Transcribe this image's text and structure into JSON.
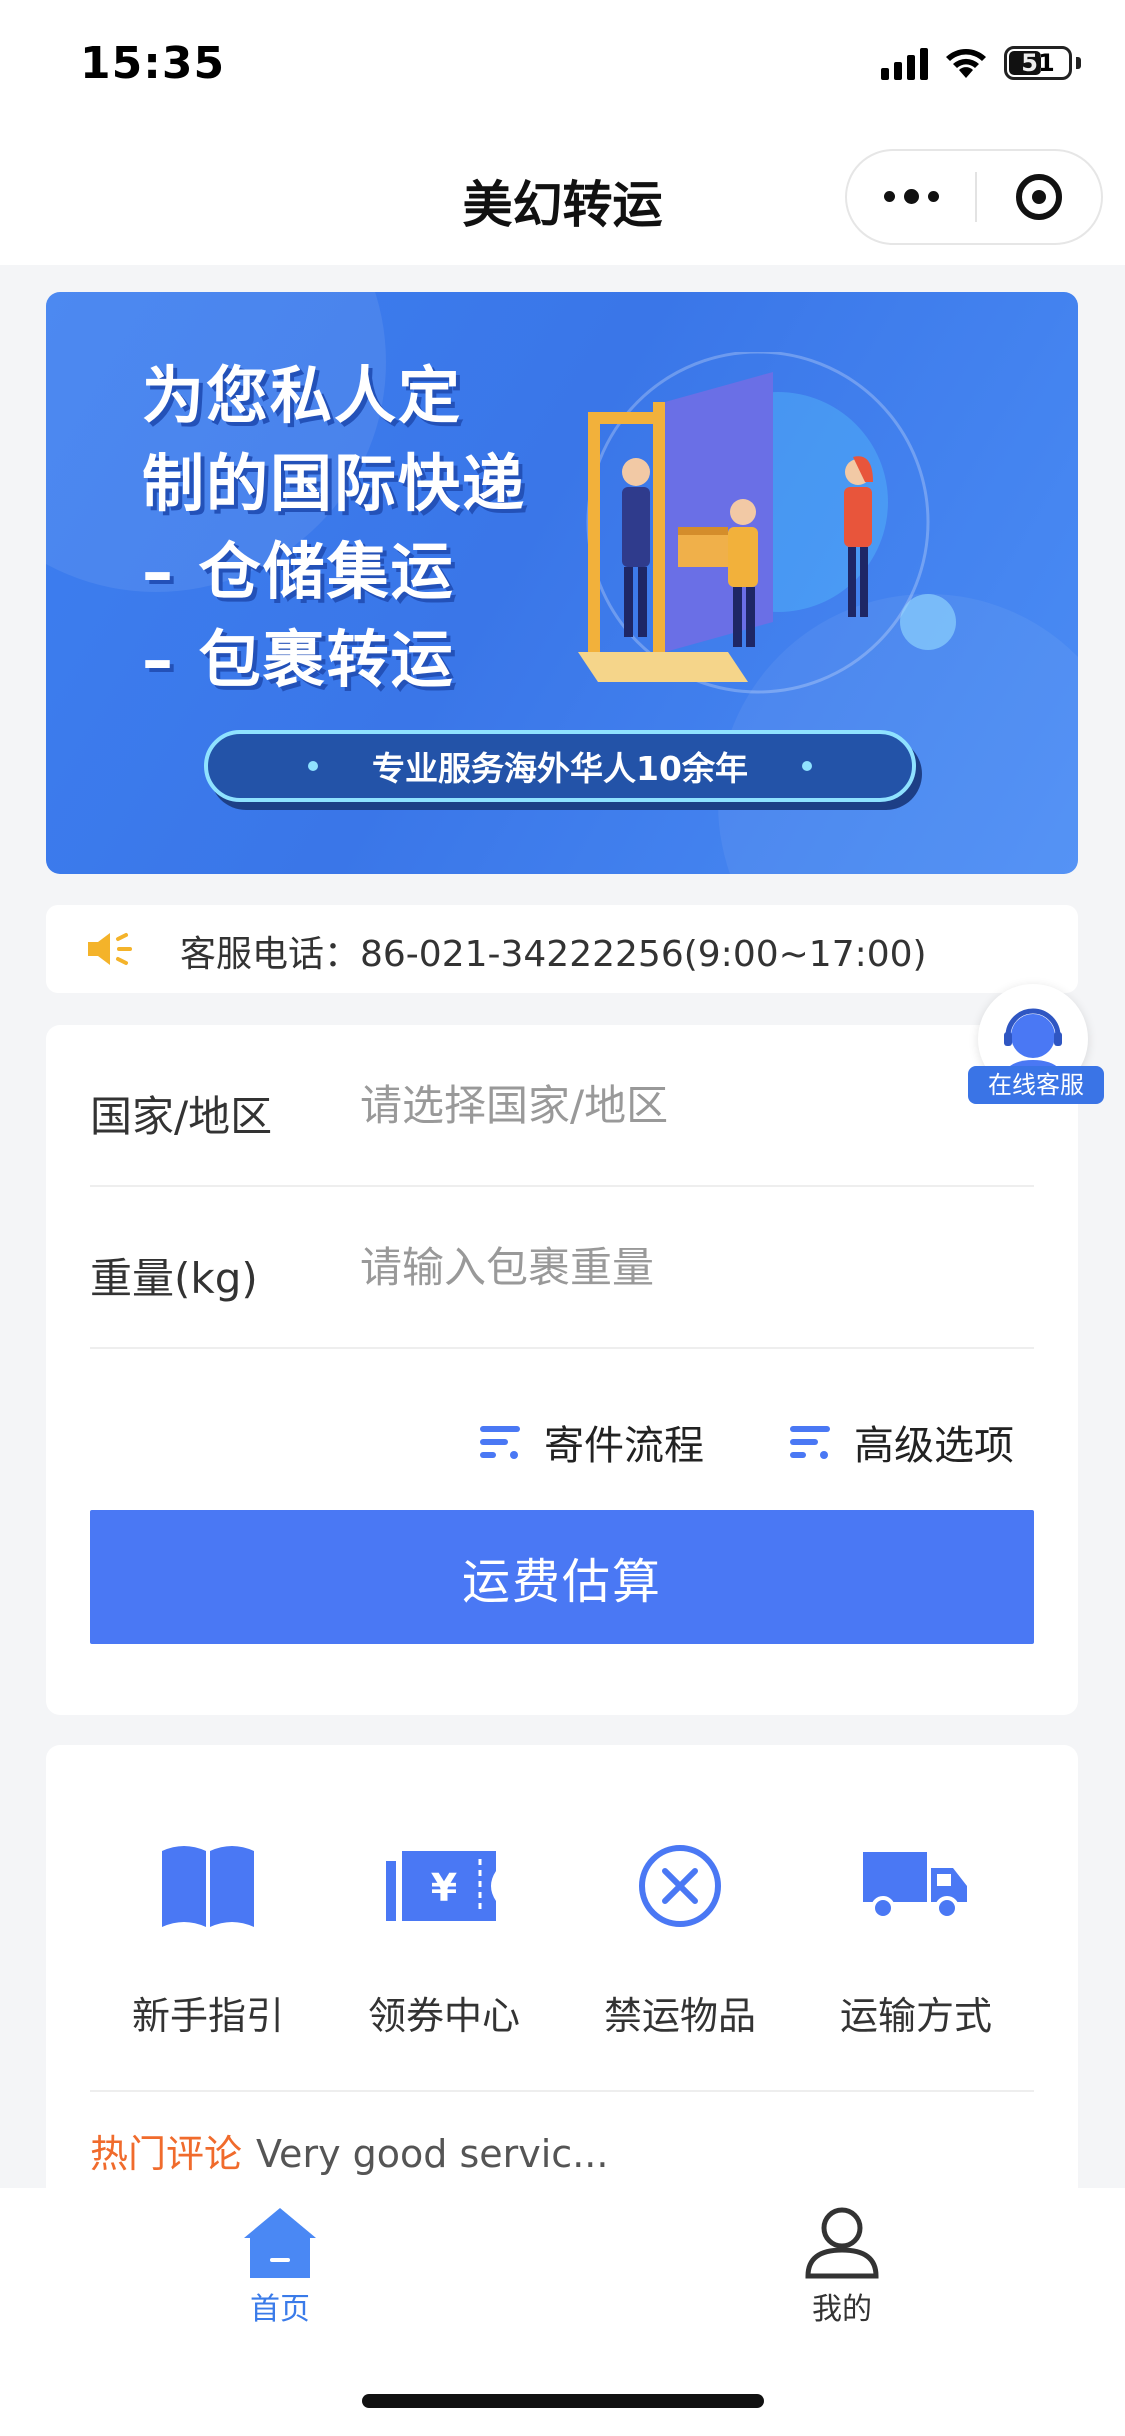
{
  "status_bar": {
    "time": "15:35",
    "battery": "51"
  },
  "nav": {
    "title": "美幻转运"
  },
  "banner": {
    "headline_lines": [
      "为您私人定",
      "制的国际快递",
      "– 仓储集运",
      "– 包裹转运"
    ],
    "tagline": "专业服务海外华人10余年",
    "accent_color": "#3a7be9"
  },
  "notice": {
    "text": "客服电话：86-021-34222256(9:00~17:00)"
  },
  "online_service": {
    "label": "在线客服"
  },
  "form": {
    "country_label": "国家/地区",
    "country_placeholder": "请选择国家/地区",
    "weight_label": "重量(kg)",
    "weight_placeholder": "请输入包裹重量",
    "process_link": "寄件流程",
    "advanced_link": "高级选项",
    "submit_label": "运费估算",
    "button_color": "#4a78f4"
  },
  "services": [
    {
      "label": "新手指引",
      "icon": "book-icon"
    },
    {
      "label": "领券中心",
      "icon": "coupon-icon"
    },
    {
      "label": "禁运物品",
      "icon": "forbidden-icon"
    },
    {
      "label": "运输方式",
      "icon": "truck-icon"
    }
  ],
  "review": {
    "prefix": "热门评论",
    "text": "Very good servic..."
  },
  "tabbar": {
    "items": [
      {
        "label": "首页",
        "active": true,
        "icon": "home-icon"
      },
      {
        "label": "我的",
        "active": false,
        "icon": "user-icon"
      }
    ],
    "active_color": "#3a7be9"
  }
}
